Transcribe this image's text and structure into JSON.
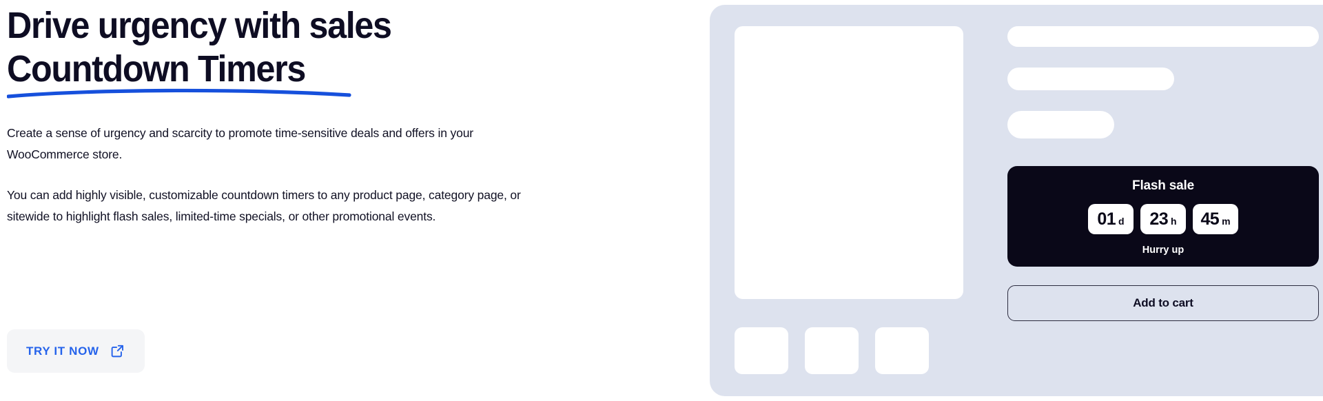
{
  "hero": {
    "headline_line_1": "Drive urgency with sales",
    "headline_line_2": "Countdown Timers",
    "underline_color": "#1650DC",
    "paragraph_1": "Create a sense of urgency and scarcity to promote time-sensitive deals and offers in your WooCommerce store.",
    "paragraph_2": "You can add highly visible, customizable countdown timers to any product page, category page, or sitewide to highlight flash sales, limited-time specials, or other promotional events.",
    "cta": {
      "label": "TRY IT NOW",
      "icon": "external-link-icon",
      "text_color": "#2563EB",
      "background_color": "#F4F5F7"
    }
  },
  "mockup": {
    "card_background": "#DDE2EE",
    "product_image_placeholder": "",
    "thumbnails": [
      "",
      "",
      ""
    ],
    "skeleton_bars": [
      "",
      "",
      ""
    ],
    "countdown": {
      "title": "Flash sale",
      "background_color": "#0A0818",
      "units": [
        {
          "value": "01",
          "unit": "d"
        },
        {
          "value": "23",
          "unit": "h"
        },
        {
          "value": "45",
          "unit": "m"
        }
      ],
      "note": "Hurry up"
    },
    "add_to_cart_label": "Add to cart"
  }
}
